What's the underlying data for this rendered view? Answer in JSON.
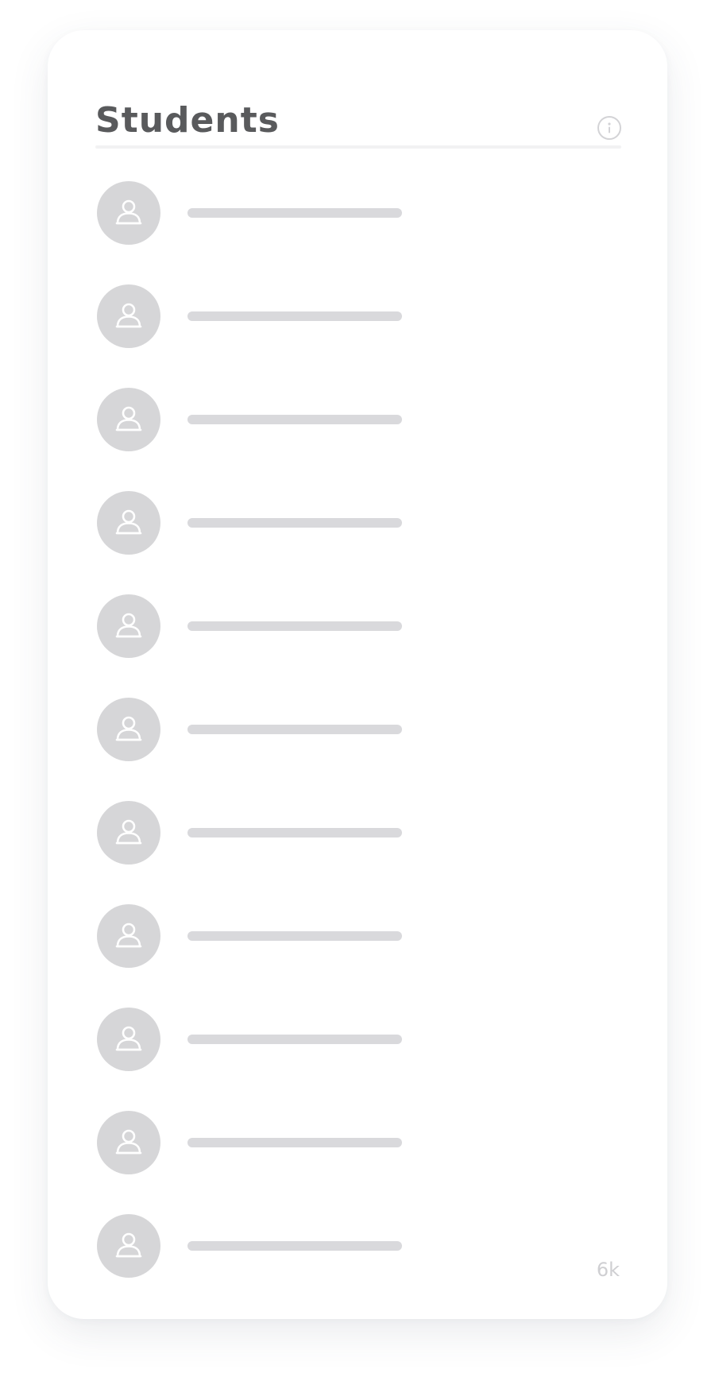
{
  "card": {
    "title": "Students",
    "info_icon": "info-icon",
    "count_label": "6k"
  },
  "students": {
    "avatar_icon": "user-icon",
    "placeholder_rows": 11
  },
  "colors": {
    "title": "#595a5c",
    "avatar_bg": "#d6d6d8",
    "skeleton_bar": "#d9d9dc",
    "muted_text": "#cfcfd2",
    "divider": "#f2f2f3"
  }
}
